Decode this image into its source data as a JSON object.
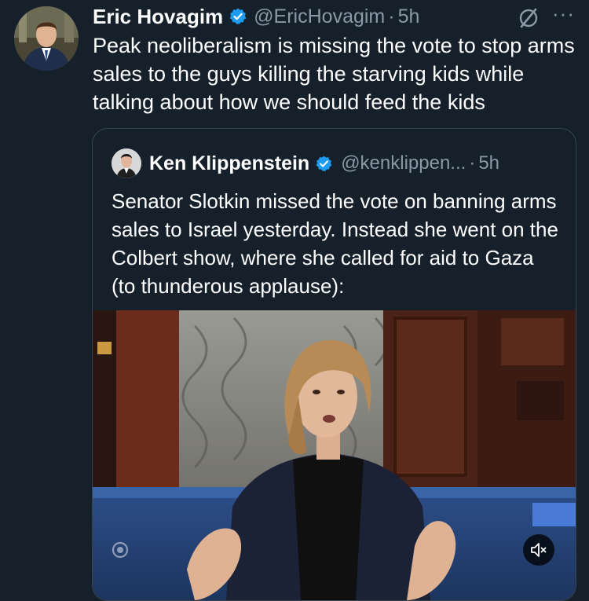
{
  "tweet": {
    "name": "Eric Hovagim",
    "handle": "@EricHovagim",
    "separator": "·",
    "time": "5h",
    "more": "···",
    "text": "Peak neoliberalism is missing the vote to stop arms sales to the guys killing the starving kids while talking about how we should feed the kids"
  },
  "quote": {
    "name": "Ken Klippenstein",
    "handle": "@kenklippen...",
    "separator": "·",
    "time": "5h",
    "text": "Senator Slotkin missed the vote on banning arms sales to Israel yesterday. Instead she went on the Colbert show, where she called for aid to Gaza (to thunderous applause):"
  },
  "colors": {
    "background": "#15202b",
    "secondary_text": "#8b98a5",
    "verified_blue": "#1d9bf0",
    "border": "#38444d"
  },
  "icons": {
    "verified": "verified-badge-icon",
    "grok": "grok-icon",
    "more": "more-icon",
    "mute": "mute-icon",
    "eye": "eye-icon"
  }
}
